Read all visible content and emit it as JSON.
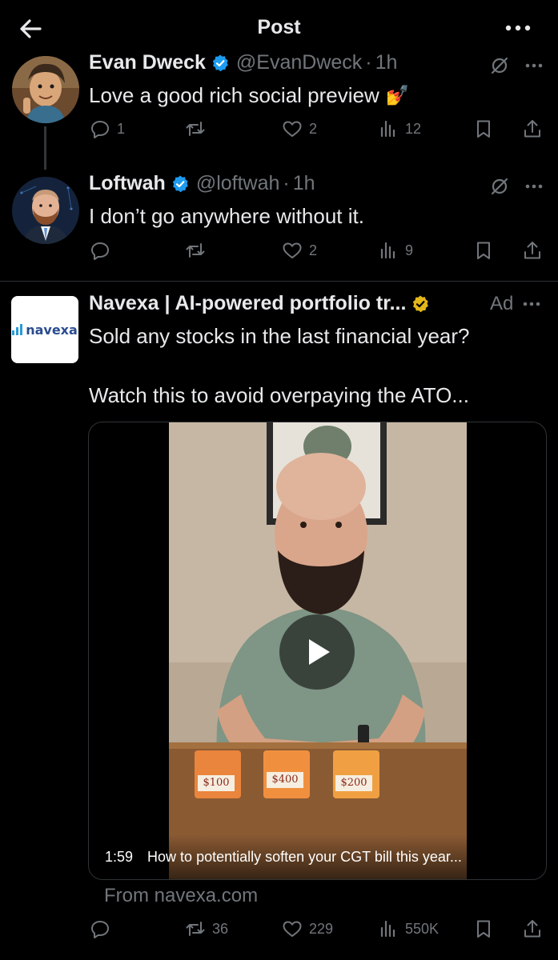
{
  "header": {
    "title": "Post"
  },
  "tweets": [
    {
      "name": "Evan Dweck",
      "handle": "@EvanDweck",
      "sep": "·",
      "time": "1h",
      "text": "Love a good rich social preview",
      "emoji": "💅",
      "stats": {
        "replies": "1",
        "retweets": "",
        "likes": "2",
        "views": "12"
      }
    },
    {
      "name": "Loftwah",
      "handle": "@loftwah",
      "sep": "·",
      "time": "1h",
      "text": "I don’t go anywhere without it.",
      "stats": {
        "replies": "",
        "retweets": "",
        "likes": "2",
        "views": "9"
      }
    }
  ],
  "ad": {
    "name": "Navexa | AI-powered portfolio tr...",
    "label": "Ad",
    "logo_text": "navexa",
    "text_line1": "Sold any stocks in the last financial year?",
    "text_line2": "Watch this to avoid overpaying the ATO...",
    "video": {
      "duration": "1:59",
      "caption": "How to potentially soften your CGT bill this year...",
      "price_tags": [
        "$100",
        "$400",
        "$200"
      ]
    },
    "from": "From navexa.com",
    "stats": {
      "replies": "",
      "retweets": "36",
      "likes": "229",
      "views": "550K"
    }
  },
  "colors": {
    "background": "#000000",
    "text": "#e7e9ea",
    "muted": "#71767b",
    "verified_blue": "#1d9bf0",
    "verified_gold": "#e2b719",
    "divider": "#2f3336"
  }
}
